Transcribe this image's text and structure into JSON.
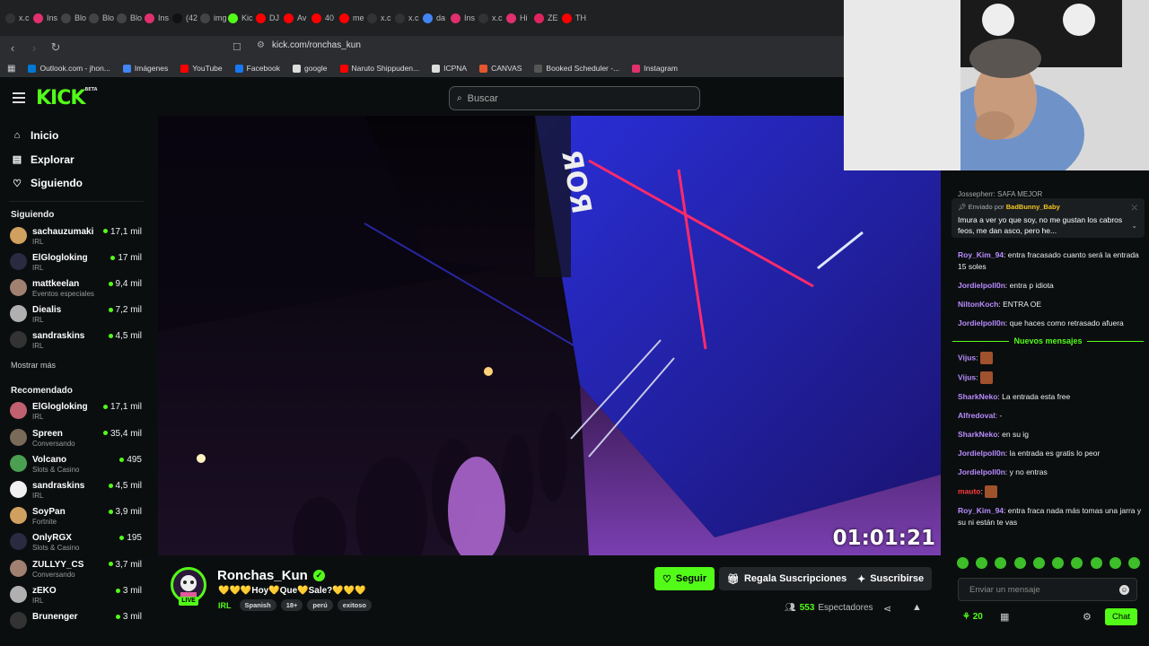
{
  "browser": {
    "tabs": [
      {
        "label": "x.c",
        "icon": "x-icon",
        "color": "#333333"
      },
      {
        "label": "Ins",
        "icon": "instagram-icon",
        "color": "#e1306c"
      },
      {
        "label": "Blo",
        "icon": "chatgpt-icon",
        "color": "#444444"
      },
      {
        "label": "Blo",
        "icon": "chatgpt-icon",
        "color": "#444444"
      },
      {
        "label": "Blo",
        "icon": "chatgpt-icon",
        "color": "#444444"
      },
      {
        "label": "Ins",
        "icon": "instagram-icon",
        "color": "#e1306c"
      },
      {
        "label": "(42",
        "icon": "tiktok-icon",
        "color": "#111111"
      },
      {
        "label": "img",
        "icon": "chatgpt-icon",
        "color": "#444444"
      },
      {
        "label": "Kic",
        "icon": "kick-icon",
        "color": "#53fc18"
      },
      {
        "label": "DJ",
        "icon": "youtube-icon",
        "color": "#ff0000"
      },
      {
        "label": "Av",
        "icon": "youtube-icon",
        "color": "#ff0000"
      },
      {
        "label": "40",
        "icon": "youtube-icon",
        "color": "#ff0000"
      },
      {
        "label": "me",
        "icon": "youtube-icon",
        "color": "#ff0000"
      },
      {
        "label": "x.c",
        "icon": "x-icon",
        "color": "#333333"
      },
      {
        "label": "x.c",
        "icon": "x-icon",
        "color": "#333333"
      },
      {
        "label": "da",
        "icon": "google-icon",
        "color": "#4285f4"
      },
      {
        "label": "Ins",
        "icon": "instagram-icon",
        "color": "#e1306c"
      },
      {
        "label": "x.c",
        "icon": "x-icon",
        "color": "#333333"
      },
      {
        "label": "Hi",
        "icon": "instagram-icon",
        "color": "#e1306c"
      },
      {
        "label": "ZE",
        "icon": "zedge-icon",
        "color": "#e0245e"
      },
      {
        "label": "TH",
        "icon": "youtube-icon",
        "color": "#ff0000"
      }
    ],
    "url": "kick.com/ronchas_kun",
    "bookmarks": [
      {
        "label": "Outlook.com - jhon...",
        "color": "#0078d4"
      },
      {
        "label": "Imágenes",
        "color": "#4285f4"
      },
      {
        "label": "YouTube",
        "color": "#ff0000"
      },
      {
        "label": "Facebook",
        "color": "#1877f2"
      },
      {
        "label": "google",
        "color": "#dddddd"
      },
      {
        "label": "Naruto Shippuden...",
        "color": "#ff0000"
      },
      {
        "label": "ICPNA",
        "color": "#dddddd"
      },
      {
        "label": "CANVAS",
        "color": "#e4572e"
      },
      {
        "label": "Booked Scheduler -...",
        "color": "#555555"
      },
      {
        "label": "Instagram",
        "color": "#e1306c"
      }
    ]
  },
  "header": {
    "logo": "KICK",
    "logo_sup": "BETA",
    "search_placeholder": "Buscar"
  },
  "sidebar": {
    "nav": [
      {
        "label": "Inicio",
        "icon": "home-icon"
      },
      {
        "label": "Explorar",
        "icon": "browse-icon"
      },
      {
        "label": "Siguiendo",
        "icon": "heart-icon"
      }
    ],
    "following_title": "Siguiendo",
    "following": [
      {
        "name": "sachauzumaki",
        "category": "IRL",
        "viewers": "17,1 mil"
      },
      {
        "name": "ElGlogloking",
        "category": "IRL",
        "viewers": "17 mil"
      },
      {
        "name": "mattkeelan",
        "category": "Eventos especiales",
        "viewers": "9,4 mil"
      },
      {
        "name": "Diealis",
        "category": "IRL",
        "viewers": "7,2 mil"
      },
      {
        "name": "sandraskins",
        "category": "IRL",
        "viewers": "4,5 mil"
      }
    ],
    "show_more": "Mostrar más",
    "recommended_title": "Recomendado",
    "recommended": [
      {
        "name": "ElGlogloking",
        "category": "IRL",
        "viewers": "17,1 mil"
      },
      {
        "name": "Spreen",
        "category": "Conversando",
        "viewers": "35,4 mil"
      },
      {
        "name": "Volcano",
        "category": "Slots & Casino",
        "viewers": "495"
      },
      {
        "name": "sandraskins",
        "category": "IRL",
        "viewers": "4,5 mil"
      },
      {
        "name": "SoyPan",
        "category": "Fortnite",
        "viewers": "3,9 mil"
      },
      {
        "name": "OnlyRGX",
        "category": "Slots & Casino",
        "viewers": "195"
      },
      {
        "name": "ZULLYY_CS",
        "category": "Conversando",
        "viewers": "3,7 mil"
      },
      {
        "name": "zEKO",
        "category": "IRL",
        "viewers": "3 mil"
      },
      {
        "name": "Brunenger",
        "category": "",
        "viewers": "3 mil"
      }
    ]
  },
  "player": {
    "timer": "01:01:21"
  },
  "stream": {
    "streamer": "Ronchas_Kun",
    "live_badge": "LIVE",
    "title": "💛💛💛Hoy💛Que💛Sale?💛💛💛",
    "category": "IRL",
    "tags": [
      "Spanish",
      "18+",
      "perú",
      "exitoso"
    ],
    "follow_label": "Seguir",
    "gift_label": "Regala Suscripciones",
    "subscribe_label": "Suscribirse",
    "viewer_count": "553",
    "viewer_label": "Espectadores"
  },
  "chat": {
    "top_partial": "Jossepherr: SAFA MEJOR",
    "pinned_by_label": "Enviado por",
    "pinned_by_user": "BadBunny_Baby",
    "pinned_text": "Imura a ver yo que soy, no me gustan los cabros feos, me dan asco, pero he...",
    "messages_before": [
      {
        "user": "Roy_Kim_94",
        "color": "#b98cff",
        "text": "entra fracasado cuanto será la entrada 15 soles"
      },
      {
        "user": "Jordielpoll0n",
        "color": "#b98cff",
        "text": "entra p idiota"
      },
      {
        "user": "NiltonKoch",
        "color": "#b98cff",
        "text": "ENTRA OE"
      },
      {
        "user": "Jordielpoll0n",
        "color": "#b98cff",
        "text": "que haces como retrasado afuera"
      }
    ],
    "new_messages_label": "Nuevos mensajes",
    "messages_after": [
      {
        "user": "Vijus",
        "color": "#b98cff",
        "text": ""
      },
      {
        "user": "Vijus",
        "color": "#b98cff",
        "text": ""
      },
      {
        "user": "SharkNeko",
        "color": "#b98cff",
        "text": "La entrada esta free"
      },
      {
        "user": "Alfredoval",
        "color": "#b98cff",
        "text": "-"
      },
      {
        "user": "SharkNeko",
        "color": "#b98cff",
        "text": "en su ig"
      },
      {
        "user": "Jordielpoll0n",
        "color": "#b98cff",
        "text": "la entrada es gratis lo peor"
      },
      {
        "user": "Jordielpoll0n",
        "color": "#b98cff",
        "text": "y no entras"
      },
      {
        "user": "mauto",
        "color": "#ff3b3b",
        "text": ""
      },
      {
        "user": "Roy_Kim_94",
        "color": "#b98cff",
        "text": "entra fraca nada más tomas una jarra y su ni están te vas"
      }
    ],
    "input_placeholder": "Enviar un mensaje",
    "points": "20",
    "chat_button": "Chat"
  },
  "colors": {
    "accent": "#53fc18",
    "background": "#0b0e0f"
  }
}
